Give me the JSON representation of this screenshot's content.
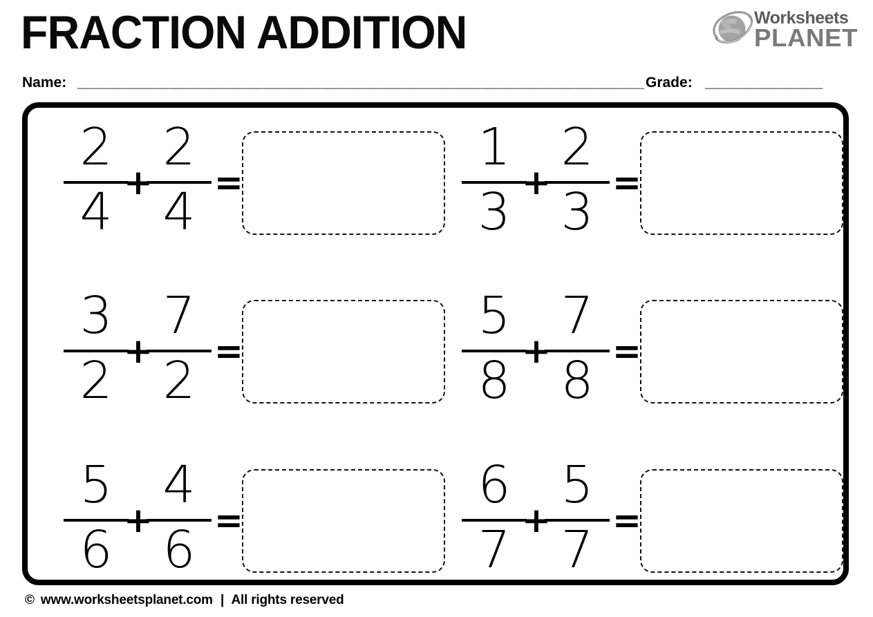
{
  "header": {
    "title": "FRACTION ADDITION",
    "logo": {
      "icon": "saturn-planet-icon",
      "line1": "Worksheets",
      "line2": "PLANET",
      "planet_color": "#a3a3a3",
      "planet_band_color": "#bcbcbc",
      "ring_color": "#9a9a9a",
      "line1_color": "#5c5c5c",
      "line2_color": "#7a7a7a"
    }
  },
  "info": {
    "name_label": "Name:",
    "name_rule": "______________________________________________________________________",
    "grade_label": "Grade:",
    "grade_rule": "______________"
  },
  "problems": [
    {
      "id": 1,
      "left_fraction": {
        "numerator": "2",
        "denominator": "4"
      },
      "operator": "+",
      "right_fraction": {
        "numerator": "2",
        "denominator": "4"
      },
      "equals": "=",
      "answer": ""
    },
    {
      "id": 2,
      "left_fraction": {
        "numerator": "1",
        "denominator": "3"
      },
      "operator": "+",
      "right_fraction": {
        "numerator": "2",
        "denominator": "3"
      },
      "equals": "=",
      "answer": ""
    },
    {
      "id": 3,
      "left_fraction": {
        "numerator": "3",
        "denominator": "2"
      },
      "operator": "+",
      "right_fraction": {
        "numerator": "7",
        "denominator": "2"
      },
      "equals": "=",
      "answer": ""
    },
    {
      "id": 4,
      "left_fraction": {
        "numerator": "5",
        "denominator": "8"
      },
      "operator": "+",
      "right_fraction": {
        "numerator": "7",
        "denominator": "8"
      },
      "equals": "=",
      "answer": ""
    },
    {
      "id": 5,
      "left_fraction": {
        "numerator": "5",
        "denominator": "6"
      },
      "operator": "+",
      "right_fraction": {
        "numerator": "4",
        "denominator": "6"
      },
      "equals": "=",
      "answer": ""
    },
    {
      "id": 6,
      "left_fraction": {
        "numerator": "6",
        "denominator": "7"
      },
      "operator": "+",
      "right_fraction": {
        "numerator": "5",
        "denominator": "7"
      },
      "equals": "=",
      "answer": ""
    }
  ],
  "footer": {
    "copyright_icon": "©",
    "website": "www.worksheetsplanet.com",
    "separator": "|",
    "rights": "All rights reserved"
  },
  "colors": {
    "ink": "#000000",
    "paper": "#ffffff",
    "border": "#000000"
  }
}
